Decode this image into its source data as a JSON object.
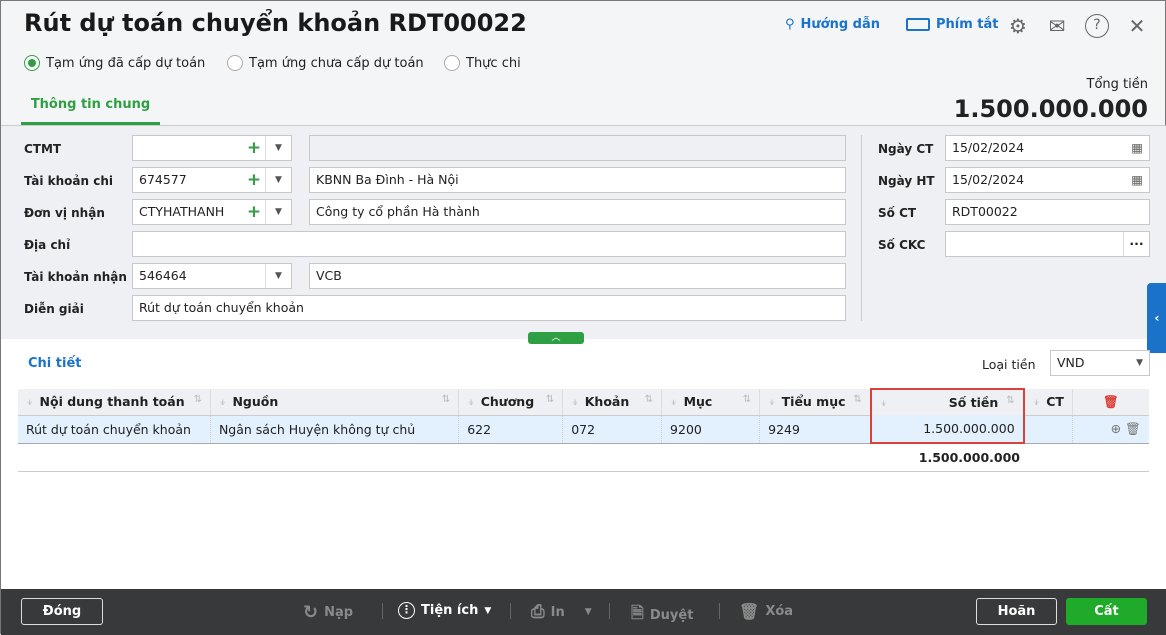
{
  "header": {
    "title": "Rút dự toán chuyển khoản RDT00022",
    "guide": "Hướng dẫn",
    "shortcuts": "Phím tắt"
  },
  "radios": [
    {
      "label": "Tạm ứng đã cấp dự toán",
      "checked": true
    },
    {
      "label": "Tạm ứng chưa cấp dự toán",
      "checked": false
    },
    {
      "label": "Thực chi",
      "checked": false
    }
  ],
  "tab": "Thông tin chung",
  "total": {
    "label": "Tổng tiền",
    "value": "1.500.000.000"
  },
  "form": {
    "ctmt": {
      "label": "CTMT",
      "code": "",
      "name": ""
    },
    "tk_chi": {
      "label": "Tài khoản chi",
      "code": "674577",
      "name": "KBNN Ba Đình - Hà Nội"
    },
    "don_vi": {
      "label": "Đơn vị nhận",
      "code": "CTYHATHANH",
      "name": "Công ty cổ phần Hà thành"
    },
    "dia_chi": {
      "label": "Địa chỉ",
      "value": ""
    },
    "tk_nhan": {
      "label": "Tài khoản nhận",
      "code": "546464",
      "name": "VCB"
    },
    "dien_giai": {
      "label": "Diễn giải",
      "value": "Rút dự toán chuyển khoản"
    },
    "ngay_ct": {
      "label": "Ngày CT",
      "value": "15/02/2024"
    },
    "ngay_ht": {
      "label": "Ngày HT",
      "value": "15/02/2024"
    },
    "so_ct": {
      "label": "Số CT",
      "value": "RDT00022"
    },
    "so_ckc": {
      "label": "Số CKC",
      "value": ""
    }
  },
  "detail": {
    "title": "Chi tiết",
    "currency_label": "Loại tiền",
    "currency": "VND",
    "columns": [
      "Nội dung thanh toán",
      "Nguồn",
      "Chương",
      "Khoản",
      "Mục",
      "Tiểu mục",
      "Số tiền",
      "CT"
    ],
    "rows": [
      [
        "Rút dự toán chuyển khoản",
        "Ngân sách Huyện không tự chủ",
        "622",
        "072",
        "9200",
        "9249",
        "1.500.000.000",
        ""
      ]
    ],
    "sum": "1.500.000.000"
  },
  "footer": {
    "close": "Đóng",
    "reload": "Nạp",
    "utilities": "Tiện ích",
    "print": "In",
    "approve": "Duyệt",
    "delete": "Xóa",
    "cancel": "Hoãn",
    "save": "Cất"
  },
  "colors": {
    "accent": "#2ea043",
    "link": "#1a73c9",
    "highlight": "#d9413a"
  }
}
